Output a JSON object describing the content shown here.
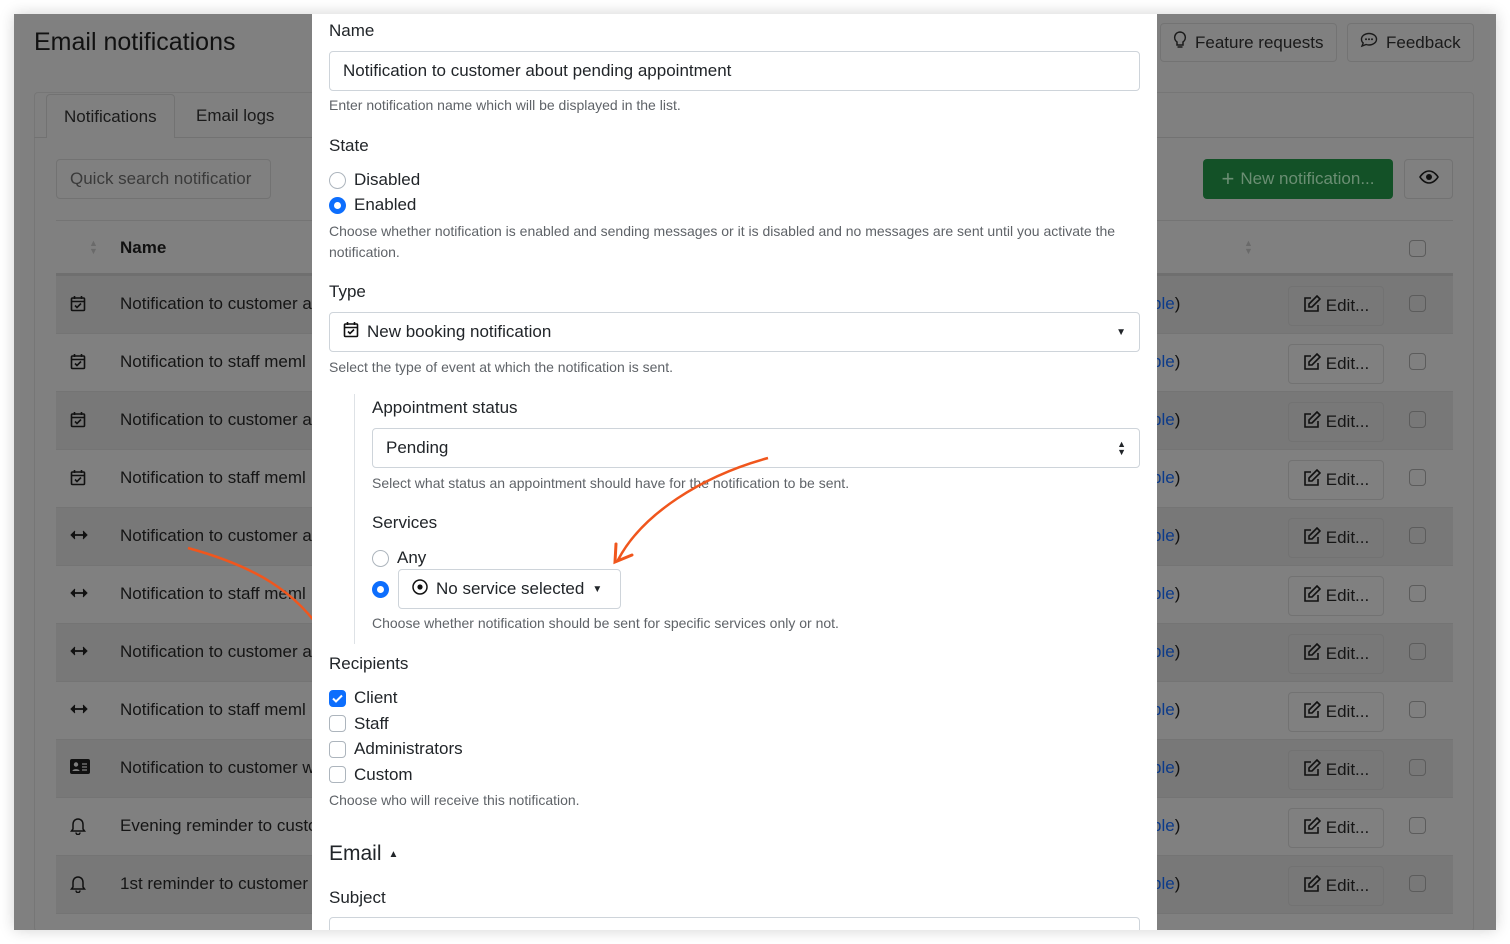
{
  "header": {
    "title": "Email notifications",
    "feature_requests": "Feature requests",
    "feedback": "Feedback"
  },
  "tabs": [
    {
      "label": "Notifications",
      "active": true
    },
    {
      "label": "Email logs"
    }
  ],
  "toolbar": {
    "search_placeholder": "Quick search notificatior",
    "new_button": "New notification...",
    "accent": "#135127"
  },
  "table": {
    "name_header": "Name",
    "rows": [
      {
        "icon": "calendar-check",
        "name": "Notification to customer a",
        "link": "ble",
        "paren": ")",
        "edit": "Edit..."
      },
      {
        "icon": "calendar-check",
        "name": "Notification to staff meml",
        "link": "ble",
        "paren": ")",
        "edit": "Edit..."
      },
      {
        "icon": "calendar-check",
        "name": "Notification to customer a",
        "link": "ble",
        "paren": ")",
        "edit": "Edit..."
      },
      {
        "icon": "calendar-check",
        "name": "Notification to staff meml",
        "link": "ble",
        "paren": ")",
        "edit": "Edit..."
      },
      {
        "icon": "arrows-horizontal",
        "name": "Notification to customer a",
        "link": "ble",
        "paren": ")",
        "edit": "Edit..."
      },
      {
        "icon": "arrows-horizontal",
        "name": "Notification to staff meml",
        "link": "ble",
        "paren": ")",
        "edit": "Edit..."
      },
      {
        "icon": "arrows-horizontal",
        "name": "Notification to customer a",
        "link": "ble",
        "paren": ")",
        "edit": "Edit..."
      },
      {
        "icon": "arrows-horizontal",
        "name": "Notification to staff meml",
        "link": "ble",
        "paren": ")",
        "edit": "Edit..."
      },
      {
        "icon": "id-card",
        "name": "Notification to customer w",
        "link": "ble",
        "paren": ")",
        "edit": "Edit..."
      },
      {
        "icon": "bell",
        "name": "Evening reminder to custo",
        "link": "ble",
        "paren": ")",
        "edit": "Edit..."
      },
      {
        "icon": "bell",
        "name": "1st reminder to customer",
        "link": "ble",
        "paren": ")",
        "edit": "Edit..."
      }
    ]
  },
  "modal": {
    "name_label": "Name",
    "name_value": "Notification to customer about pending appointment",
    "name_help": "Enter notification name which will be displayed in the list.",
    "state_label": "State",
    "state_options": [
      {
        "label": "Disabled",
        "checked": false
      },
      {
        "label": "Enabled",
        "checked": true
      }
    ],
    "state_help": "Choose whether notification is enabled and sending messages or it is disabled and no messages are sent until you activate the notification.",
    "type_label": "Type",
    "type_value": "New booking notification",
    "type_help": "Select the type of event at which the notification is sent.",
    "status_label": "Appointment status",
    "status_value": "Pending",
    "status_help": "Select what status an appointment should have for the notification to be sent.",
    "services_label": "Services",
    "services_any": "Any",
    "services_dropdown": "No service selected",
    "services_help": "Choose whether notification should be sent for specific services only or not.",
    "recipients_label": "Recipients",
    "recipients": [
      {
        "label": "Client",
        "checked": true
      },
      {
        "label": "Staff",
        "checked": false
      },
      {
        "label": "Administrators",
        "checked": false
      },
      {
        "label": "Custom",
        "checked": false
      }
    ],
    "recipients_help": "Choose who will receive this notification.",
    "email_section": "Email",
    "subject_label": "Subject",
    "accent": "#0d6efd",
    "annotation_color": "#f0561d"
  }
}
